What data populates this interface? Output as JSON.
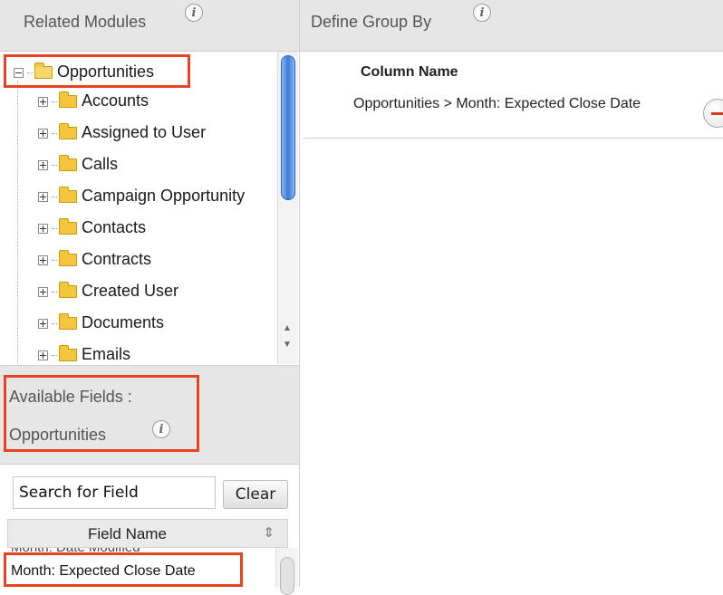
{
  "left_panel": {
    "header": {
      "title": "Related Modules"
    },
    "tree": {
      "root": {
        "label": "Opportunities"
      },
      "items": [
        {
          "label": "Accounts"
        },
        {
          "label": "Assigned to User"
        },
        {
          "label": "Calls"
        },
        {
          "label": "Campaign Opportunity"
        },
        {
          "label": "Contacts"
        },
        {
          "label": "Contracts"
        },
        {
          "label": "Created User"
        },
        {
          "label": "Documents"
        },
        {
          "label": "Emails"
        }
      ]
    },
    "available_fields": {
      "line1": "Available Fields :",
      "line2": "Opportunities"
    },
    "search": {
      "value": "Search for Field"
    },
    "clear_label": "Clear",
    "field_table": {
      "header": "Field Name",
      "cut_row": "Month: Date Modified",
      "rows": [
        "Month: Expected Close Date"
      ]
    }
  },
  "right_panel": {
    "header": {
      "title": "Define Group By"
    },
    "column_header": "Column Name",
    "group_value": "Opportunities > Month: Expected Close Date"
  },
  "colors": {
    "highlight": "#e8431f",
    "header_bg": "#e6e6e6",
    "scroll_thumb": "#3e7ad8"
  }
}
